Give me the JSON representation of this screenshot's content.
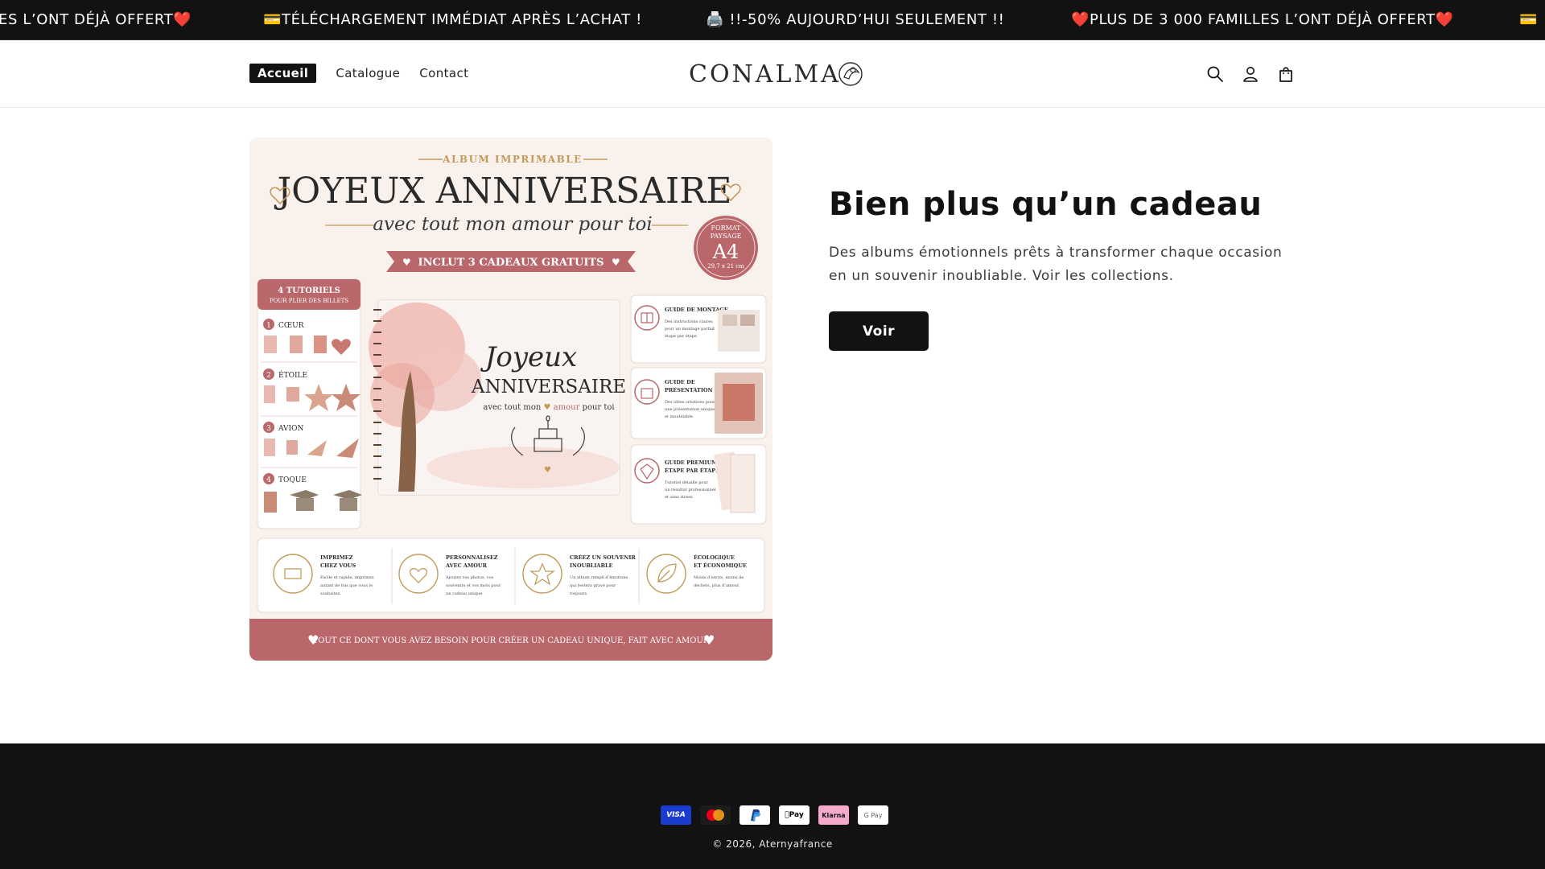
{
  "announcement": {
    "messages": [
      "ES L’ONT DÉJÀ OFFERT❤️",
      "💳TÉLÉCHARGEMENT IMMÉDIAT APRÈS L’ACHAT !",
      "🖨️ !!-50% AUJOURD’HUI SEULEMENT !!",
      "❤️PLUS DE 3 000 FAMILLES L’ONT DÉJÀ OFFERT❤️",
      "💳"
    ]
  },
  "header": {
    "nav": [
      {
        "label": "Accueil"
      },
      {
        "label": "Catalogue"
      },
      {
        "label": "Contact"
      }
    ],
    "logo_text": "CONALMA",
    "icons": [
      "search-icon",
      "account-icon",
      "cart-icon"
    ]
  },
  "hero": {
    "image": {
      "badge_top": "ALBUM IMPRIMABLE",
      "title": "JOYEUX ANNIVERSAIRE",
      "subtitle": "avec tout mon amour pour toi",
      "ribbon": "INCLUT 3 CADEAUX GRATUITS",
      "format": {
        "line1": "FORMAT",
        "line2": "PAYSAGE",
        "size": "A4",
        "dims": "29,7 x 21 cm"
      },
      "tutorials_title": "4 TUTORIELS",
      "tutorials_sub": "POUR PLIER DES BILLETS",
      "tutorials": [
        {
          "num": "1",
          "label": "CŒUR"
        },
        {
          "num": "2",
          "label": "ÉTOILE"
        },
        {
          "num": "3",
          "label": "AVION"
        },
        {
          "num": "4",
          "label": "TOQUE"
        }
      ],
      "book_script": "Joyeux",
      "book_title": "ANNIVERSAIRE",
      "book_sub": "avec tout mon",
      "book_sub_accent": "amour",
      "book_sub_end": "pour toi",
      "guides": [
        {
          "title1": "GUIDE DE MONTAGE",
          "title2": "",
          "desc": [
            "Des instructions claires",
            "pour un montage parfait",
            "étape par étape."
          ]
        },
        {
          "title1": "GUIDE DE",
          "title2": "PRÉSENTATION",
          "desc": [
            "Des idées créatives pour",
            "une présentation unique",
            "et inoubliable."
          ]
        },
        {
          "title1": "GUIDE PREMIUM",
          "title2": "ÉTAPE PAR ÉTAPE",
          "desc": [
            "Tutoriel détaillé pour",
            "un résultat professionnel",
            "et sans stress."
          ]
        }
      ],
      "features": [
        {
          "title1": "IMPRIMEZ",
          "title2": "CHEZ VOUS",
          "desc": [
            "Facile et rapide, imprimez",
            "autant de fois que vous le",
            "souhaitez."
          ]
        },
        {
          "title1": "PERSONNALISEZ",
          "title2": "AVEC AMOUR",
          "desc": [
            "Ajoutez vos photos, vos",
            "souvenirs et vos mots pour",
            "un cadeau unique."
          ]
        },
        {
          "title1": "CRÉEZ UN SOUVENIR",
          "title2": "INOUBLIABLE",
          "desc": [
            "Un album rempli d’émotions",
            "qui restera gravé pour",
            "toujours."
          ]
        },
        {
          "title1": "ÉCOLOGIQUE",
          "title2": "ET ÉCONOMIQUE",
          "desc": [
            "Moins d’encre, moins de",
            "déchets, plus d’amour."
          ]
        }
      ],
      "bottom_banner": "TOUT CE DONT VOUS AVEZ BESOIN POUR CRÉER UN CADEAU UNIQUE, FAIT AVEC AMOUR"
    },
    "heading": "Bien plus qu’un cadeau",
    "text": "Des albums émotionnels prêts à transformer chaque occasion en un souvenir inoubliable. Voir les collections.",
    "button": "Voir"
  },
  "footer": {
    "payments": [
      "VISA",
      "Mastercard",
      "PayPal",
      "Apple Pay",
      "Klarna",
      "G Pay"
    ],
    "copyright": "© 2026, Aternyafrance"
  },
  "colors": {
    "dark": "#121212",
    "rose": "#b9676b",
    "gold": "#c49a5c",
    "cream": "#f8efe9"
  }
}
